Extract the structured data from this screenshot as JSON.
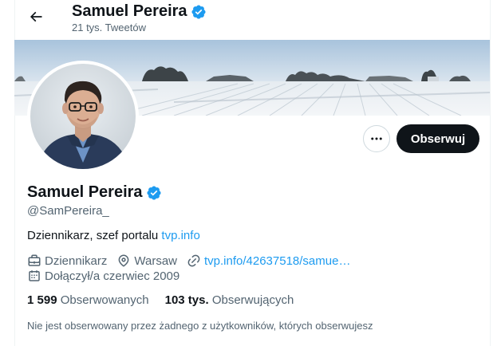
{
  "header": {
    "name": "Samuel Pereira",
    "tweet_count": "21 tys. Tweetów"
  },
  "profile": {
    "name": "Samuel Pereira",
    "handle": "@SamPereira_",
    "bio_text": "Dziennikarz, szef portalu",
    "bio_link": "tvp.info",
    "profession": "Dziennikarz",
    "location": "Warsaw",
    "website": "tvp.info/42637518/samue…",
    "joined": "Dołączył/a czerwiec 2009"
  },
  "actions": {
    "follow_label": "Obserwuj"
  },
  "stats": {
    "following_count": "1 599",
    "following_label": "Obserwowanych",
    "followers_count": "103 tys.",
    "followers_label": "Obserwujących"
  },
  "followers_note": "Nie jest obserwowany przez żadnego z użytkowników, których obserwujesz",
  "colors": {
    "accent": "#1d9bf0",
    "text": "#0f1419",
    "muted": "#536471",
    "button_dark": "#0f1419"
  },
  "icons": {
    "back": "arrow-left-icon",
    "verified": "verified-badge-icon",
    "more": "more-horizontal-icon",
    "briefcase": "briefcase-icon",
    "location": "location-pin-icon",
    "link": "link-icon",
    "calendar": "calendar-icon"
  }
}
